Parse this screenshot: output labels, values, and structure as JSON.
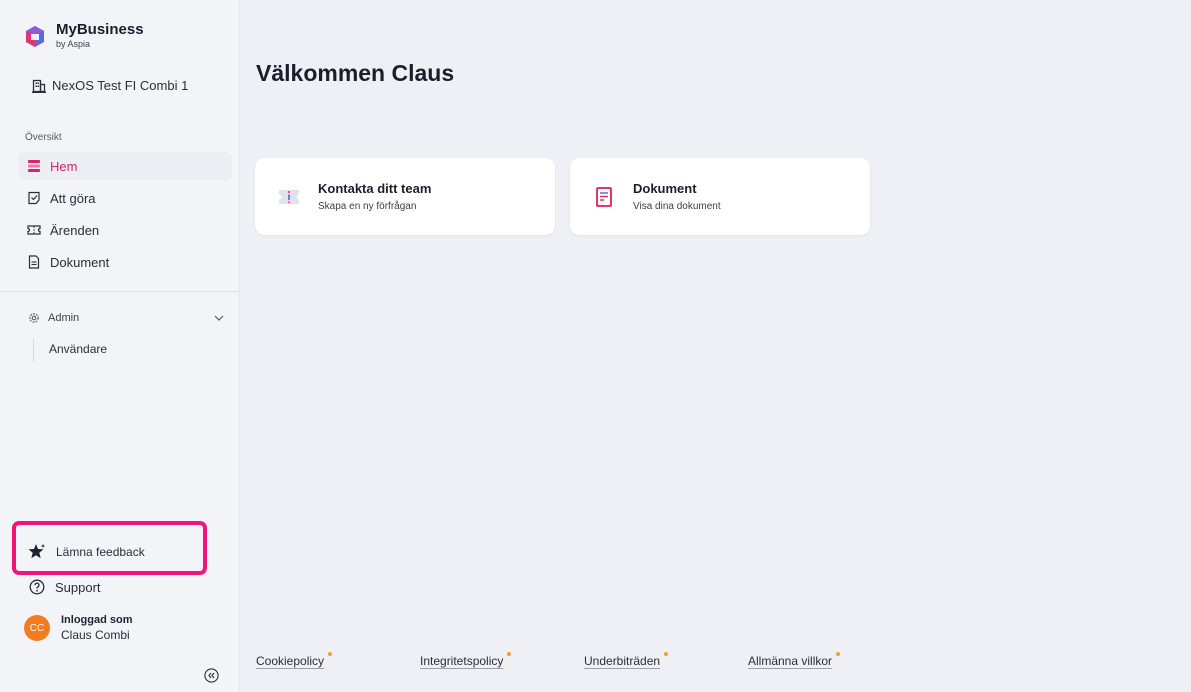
{
  "brand": {
    "name": "MyBusiness",
    "sub": "by Aspia"
  },
  "org": {
    "name": "NexOS Test FI Combi 1"
  },
  "nav": {
    "section_label": "Översikt",
    "items": [
      {
        "label": "Hem",
        "icon": "home-icon",
        "active": true
      },
      {
        "label": "Att göra",
        "icon": "todo-icon",
        "active": false
      },
      {
        "label": "Ärenden",
        "icon": "ticket-icon",
        "active": false
      },
      {
        "label": "Dokument",
        "icon": "document-icon",
        "active": false
      }
    ]
  },
  "admin": {
    "label": "Admin",
    "sub_items": [
      {
        "label": "Användare"
      }
    ]
  },
  "bottom": {
    "feedback_label": "Lämna feedback",
    "support_label": "Support",
    "user": {
      "initials": "CC",
      "label": "Inloggad som",
      "name": "Claus Combi"
    }
  },
  "main": {
    "title": "Välkommen Claus",
    "cards": [
      {
        "title": "Kontakta ditt team",
        "subtitle": "Skapa en ny förfrågan",
        "icon": "ticket-icon"
      },
      {
        "title": "Dokument",
        "subtitle": "Visa dina dokument",
        "icon": "document-icon"
      }
    ]
  },
  "footer": {
    "links": [
      {
        "label": "Cookiepolicy"
      },
      {
        "label": "Integritetspolicy"
      },
      {
        "label": "Underbiträden"
      },
      {
        "label": "Allmänna villkor"
      }
    ]
  },
  "colors": {
    "accent": "#d6246e",
    "highlight": "#f0157a",
    "avatar": "#f47b20",
    "link_dot": "#f4a020"
  }
}
